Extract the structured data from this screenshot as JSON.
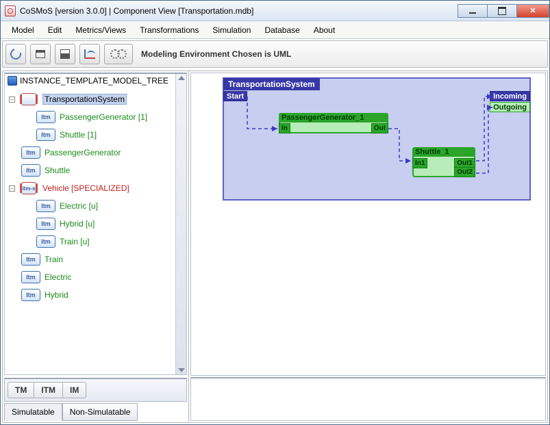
{
  "window": {
    "title": "CoSMoS [version 3.0.0] | Component View [Transportation.mdb]"
  },
  "menu": {
    "items": [
      "Model",
      "Edit",
      "Metrics/Views",
      "Transformations",
      "Simulation",
      "Database",
      "About"
    ]
  },
  "toolbar": {
    "status": "Modeling Environment Chosen is UML"
  },
  "tree": {
    "header": "INSTANCE_TEMPLATE_MODEL_TREE",
    "root": {
      "label": "TransportationSystem"
    },
    "root_children": [
      {
        "label": "PassengerGenerator [1]"
      },
      {
        "label": "Shuttle [1]"
      }
    ],
    "siblings": [
      {
        "label": "PassengerGenerator"
      },
      {
        "label": "Shuttle"
      }
    ],
    "vehicle": {
      "label": "Vehicle [SPECIALIZED]"
    },
    "vehicle_children": [
      {
        "label": "Electric [u]"
      },
      {
        "label": "Hybrid [u]"
      },
      {
        "label": "Train [u]"
      }
    ],
    "rest": [
      {
        "label": "Train"
      },
      {
        "label": "Electric"
      },
      {
        "label": "Hybrid"
      }
    ],
    "badge_itm": "Itm",
    "badge_itms": "itm-s"
  },
  "model_tabs": {
    "items": [
      "TM",
      "ITM",
      "IM"
    ]
  },
  "sim_tabs": {
    "items": [
      "Simulatable",
      "Non-Simulatable"
    ]
  },
  "diagram": {
    "container": "TransportationSystem",
    "start": "Start",
    "incoming": "Incoming",
    "outgoing": "Outgoing",
    "node1": {
      "title": "PassengerGenerator_1",
      "in": "In",
      "out": "Out"
    },
    "node2": {
      "title": "Shuttle_1",
      "in": "In1",
      "out1": "Out1",
      "out2": "Out2"
    }
  }
}
